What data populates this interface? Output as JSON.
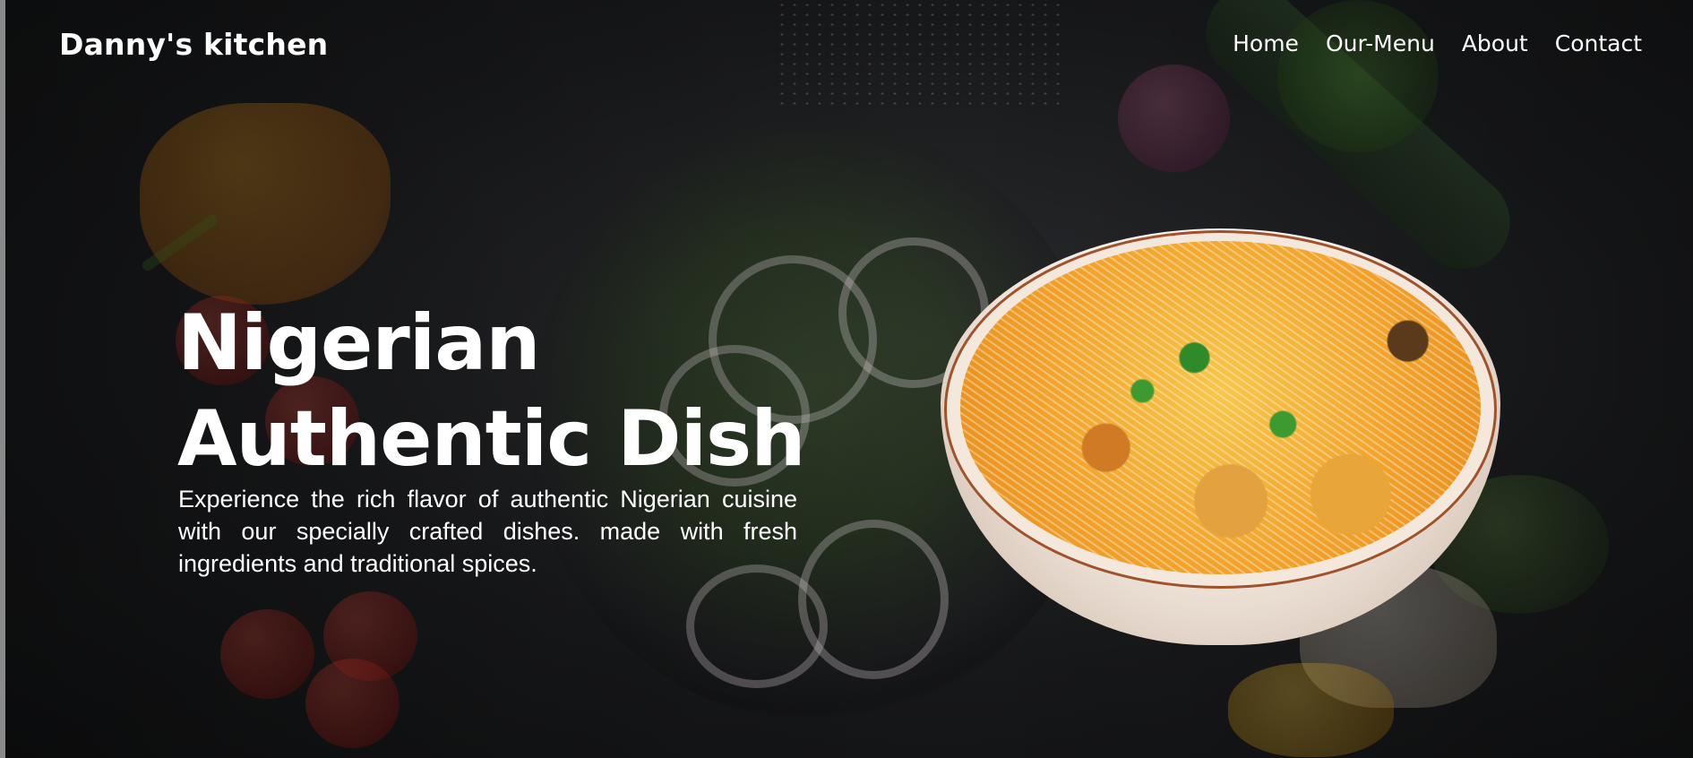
{
  "header": {
    "brand": "Danny's kitchen",
    "nav": {
      "home": "Home",
      "menu": "Our-Menu",
      "about": "About",
      "contact": "Contact"
    }
  },
  "hero": {
    "headline_line1": "Nigerian",
    "headline_line2": "Authentic Dish",
    "description": "Experience the rich flavor of authentic Nigerian cuisine with our specially crafted dishes. made with fresh ingredients and traditional spices."
  },
  "colors": {
    "background": "#151618",
    "text": "#ffffff"
  }
}
